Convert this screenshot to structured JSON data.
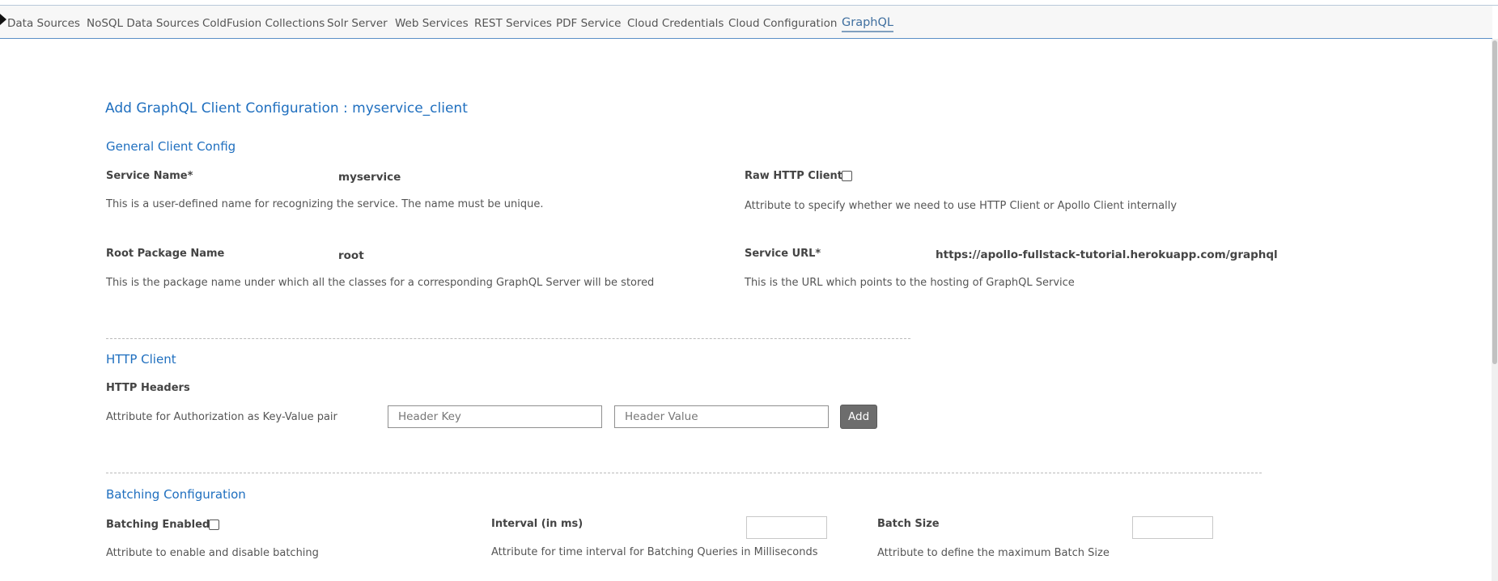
{
  "nav": {
    "tabs": [
      {
        "label": "Data Sources"
      },
      {
        "label": "NoSQL Data Sources"
      },
      {
        "label": "ColdFusion Collections"
      },
      {
        "label": "Solr Server"
      },
      {
        "label": "Web Services"
      },
      {
        "label": "REST Services"
      },
      {
        "label": "PDF Service"
      },
      {
        "label": "Cloud Credentials"
      },
      {
        "label": "Cloud Configuration"
      },
      {
        "label": "GraphQL"
      }
    ],
    "active_tab": "GraphQL"
  },
  "page": {
    "title": "Add GraphQL Client Configuration : myservice_client"
  },
  "general": {
    "section_title": "General Client Config",
    "service_name": {
      "label": "Service Name*",
      "value": "myservice",
      "description": "This is a user-defined name for recognizing the service. The name must be unique."
    },
    "raw_http_client": {
      "label": "Raw HTTP Client",
      "checked": false,
      "description": "Attribute to specify whether we need to use HTTP Client or Apollo Client internally"
    },
    "root_package": {
      "label": "Root Package Name",
      "value": "root",
      "description": "This is the package name under which all the classes for a corresponding GraphQL Server will be stored"
    },
    "service_url": {
      "label": "Service URL*",
      "value": "https://apollo-fullstack-tutorial.herokuapp.com/graphql",
      "description": "This is the URL which points to the hosting of GraphQL Service"
    }
  },
  "http_client": {
    "section_title": "HTTP Client",
    "headers_label": "HTTP Headers",
    "headers_description": "Attribute for Authorization as Key-Value pair",
    "key_placeholder": "Header Key",
    "value_placeholder": "Header Value",
    "add_label": "Add"
  },
  "batching": {
    "section_title": "Batching Configuration",
    "enabled": {
      "label": "Batching Enabled",
      "checked": false,
      "description": "Attribute to enable and disable batching"
    },
    "interval": {
      "label": "Interval (in ms)",
      "value": "",
      "description": "Attribute for time interval for Batching Queries in Milliseconds"
    },
    "batch_size": {
      "label": "Batch Size",
      "value": "",
      "description": "Attribute to define the maximum Batch Size"
    }
  }
}
